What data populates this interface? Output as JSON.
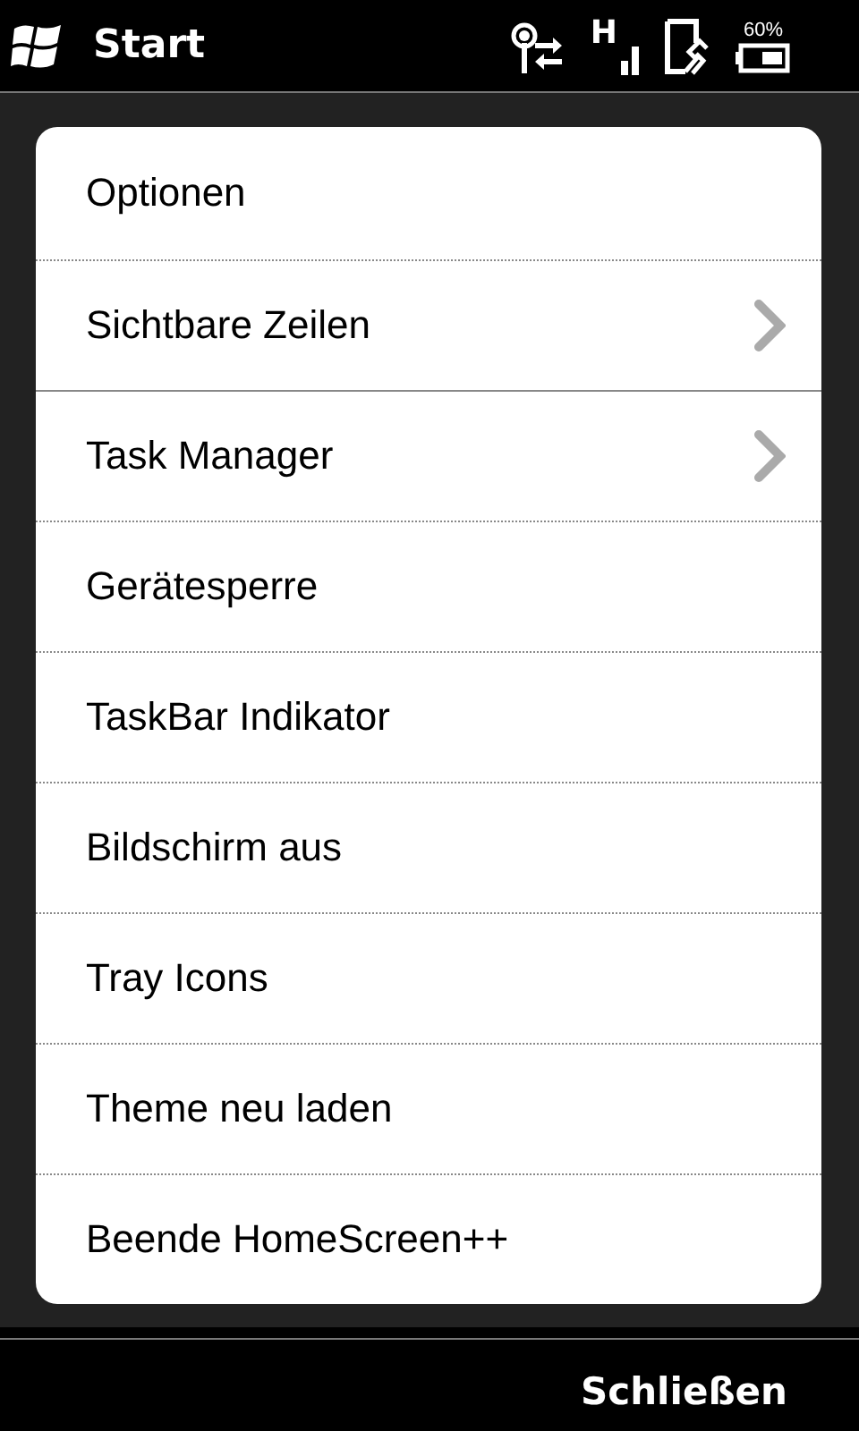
{
  "status_bar": {
    "start_label": "Start",
    "network_type": "H",
    "battery_text": "60%"
  },
  "menu": {
    "groups": [
      [
        {
          "label": "Optionen",
          "submenu": false
        },
        {
          "label": "Sichtbare Zeilen",
          "submenu": true
        }
      ],
      [
        {
          "label": "Task Manager",
          "submenu": true
        },
        {
          "label": "Gerätesperre",
          "submenu": false
        },
        {
          "label": "TaskBar Indikator",
          "submenu": false
        },
        {
          "label": "Bildschirm aus",
          "submenu": false
        },
        {
          "label": "Tray Icons",
          "submenu": false
        },
        {
          "label": "Theme neu laden",
          "submenu": false
        },
        {
          "label": "Beende HomeScreen++",
          "submenu": false
        }
      ]
    ]
  },
  "softkey": "Schließen"
}
